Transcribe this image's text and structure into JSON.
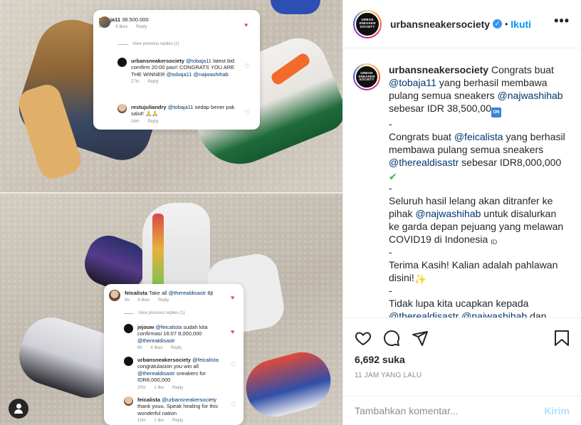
{
  "post_image": {
    "card_a": {
      "top_comment": {
        "user": "tobaja11",
        "text": "38.500.000",
        "time": "50m",
        "likes": "6 likes",
        "reply": "Reply"
      },
      "view_previous": "View previous replies (1)",
      "reply1": {
        "user": "urbansneakersociety",
        "mention": "@tobaja11",
        "text": "latest bid comfirm 20:00 pas!! CONGRATS YOU ARE THE WINNER",
        "mention2": "@tobaja11",
        "mention3": "@najwashihab",
        "time": "27m",
        "reply": "Reply"
      },
      "reply2": {
        "user": "restujuliandry",
        "mention": "@tobaja11",
        "text": "sedap bener pak salut!",
        "time": "16m",
        "reply": "Reply"
      }
    },
    "card_b": {
      "top_comment": {
        "user": "feicalista",
        "text": "Take all",
        "mention": "@therealdisastr",
        "text2": "8jt",
        "time": "8h",
        "likes": "6 likes",
        "reply": "Reply"
      },
      "view_previous": "View previous replies (1)",
      "reply1": {
        "user": "jejouw",
        "mention": "@feicalista",
        "text": "sudah kita confirmasi 16:07 8,000,000",
        "mention2": "@therealdisastr",
        "time": "6h",
        "likes": "4 likes",
        "reply": "Reply"
      },
      "reply2": {
        "user": "urbansneakersociety",
        "mention": "@feicalista",
        "text": "congratulasion you win all",
        "mention2": "@therealdisastr",
        "text2": "sneakers for IDR8,000,000",
        "time": "25m",
        "likes": "1 like",
        "reply": "Reply"
      },
      "reply3": {
        "user": "feicalista",
        "mention": "@urbansneakersociety",
        "text": "thank youu. Speak healing for this wonderful nation",
        "time": "15m",
        "likes": "1 like",
        "reply": "Reply"
      }
    }
  },
  "header": {
    "logo_text": "URBAN SNEAKER SOCIETY",
    "username": "urbansneakersociety",
    "verified_mark": "✓",
    "separator": "•",
    "follow_label": "Ikuti",
    "more_label": "•••"
  },
  "caption": {
    "username": "urbansneakersociety",
    "lines": {
      "l1_pre": "Congrats buat",
      "l1_mention": "@tobaja11",
      "l1_post": "yang berhasil membawa pulang semua sneakers",
      "l1_mention2": "@najwashihab",
      "l1_end": "sebesar IDR 38,500,00",
      "l1_emoji": "ON",
      "dash1": "-",
      "l2_pre": "Congrats buat",
      "l2_mention": "@feicalista",
      "l2_post": "yang berhasil membawa pulang semua sneakers",
      "l2_mention2": "@therealdisastr",
      "l2_end": "sebesar IDR8,000,000",
      "l2_emoji": "✔",
      "dash2": "-",
      "l3_pre": "Seluruh hasil lelang akan ditranfer ke pihak",
      "l3_mention": "@najwashihab",
      "l3_post": "untuk disalurkan ke garda depan pejuang yang melawan COVID19 di Indonesia",
      "l3_emoji": "ID",
      "dash3": "-",
      "l4": "Terima Kasih! Kalian adalah pahlawan disini!",
      "l4_emoji": "✨",
      "dash4": "-",
      "l5_pre": "Tidak lupa kita ucapkan kepada",
      "l5_mention": "@therealdisastr",
      "l5_mention2": "@najwashihab",
      "l5_post": "dan"
    }
  },
  "actions": {
    "likes": "6,692 suka",
    "time": "11 JAM YANG LALU"
  },
  "comment": {
    "placeholder": "Tambahkan komentar...",
    "post_label": "Kirim"
  },
  "icons": {
    "like": "heart-icon",
    "comment": "comment-icon",
    "share": "share-icon",
    "save": "bookmark-icon",
    "more": "more-icon",
    "profile": "user-icon"
  },
  "colors": {
    "accent": "#0095f6",
    "verified": "#3897f0",
    "mention": "#00376b",
    "like_red": "#ed4956"
  }
}
